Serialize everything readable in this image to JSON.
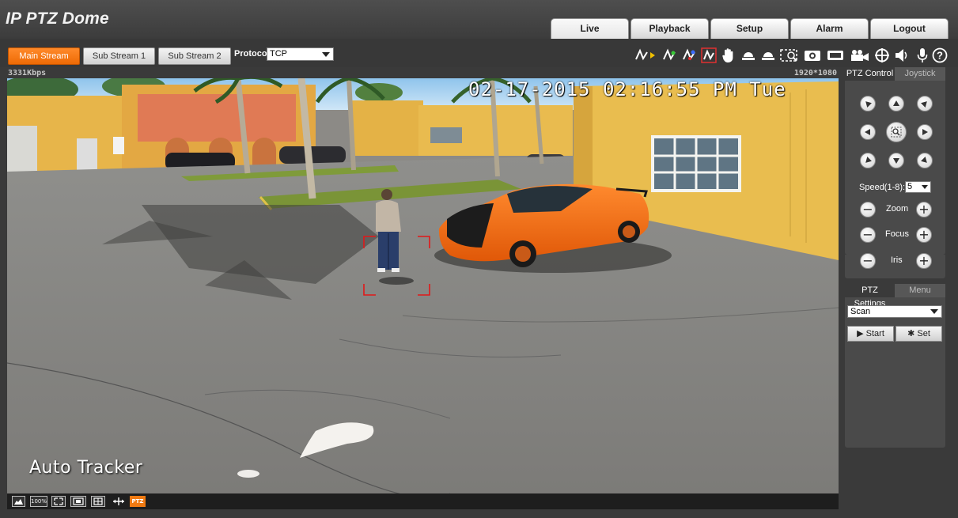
{
  "app": {
    "title": "IP PTZ Dome"
  },
  "nav": {
    "tabs": [
      {
        "label": "Live",
        "active": true
      },
      {
        "label": "Playback",
        "active": false
      },
      {
        "label": "Setup",
        "active": false
      },
      {
        "label": "Alarm",
        "active": false
      },
      {
        "label": "Logout",
        "active": false
      }
    ]
  },
  "streams": {
    "main_label": "Main Stream",
    "sub1_label": "Sub Stream 1",
    "sub2_label": "Sub Stream 2",
    "protocol_label": "Protocol",
    "protocol_value": "TCP"
  },
  "toolbar_icons": [
    "line-draw-icon",
    "arrow-right-icon",
    "green-line-icon",
    "blue-red-line-icon",
    "color-line-icon",
    "hand-icon",
    "dome-camera-icon",
    "dome-camera-2-icon",
    "region-zoom-icon",
    "snapshot-icon",
    "record-icon",
    "video-camera-icon",
    "crosshair-icon",
    "speaker-icon",
    "microphone-icon",
    "help-icon"
  ],
  "video": {
    "bitrate": "3331Kbps",
    "resolution": "1920*1080",
    "osd_time": "02-17-2015 02:16:55 PM Tue",
    "osd_title": "Auto Tracker"
  },
  "video_bar": {
    "zoom_label": "100%",
    "ptz_label": "PTZ"
  },
  "ptz_control": {
    "tab_control": "PTZ Control",
    "tab_joystick": "Joystick",
    "speed_label": "Speed(1-8):",
    "speed_value": "5",
    "zoom_label": "Zoom",
    "focus_label": "Focus",
    "iris_label": "Iris"
  },
  "ptz_settings": {
    "tab_settings": "PTZ Settings",
    "tab_menu": "Menu",
    "mode_value": "Scan",
    "start_label": "Start",
    "set_label": "Set"
  },
  "colors": {
    "accent": "#f07a12",
    "car": "#f26a14",
    "building": "#e6b546",
    "tracking_box": "#e11818"
  }
}
